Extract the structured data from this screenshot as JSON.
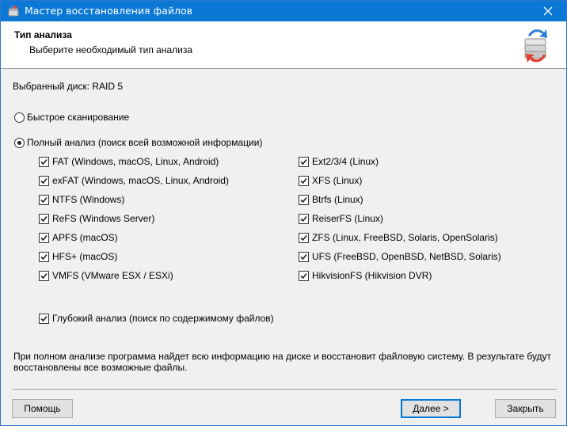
{
  "window": {
    "title": "Мастер восстановления файлов",
    "close_label": "✕"
  },
  "header": {
    "title": "Тип анализа",
    "subtitle": "Выберите необходимый тип анализа",
    "icon": "restore-drive-icon"
  },
  "disk": {
    "label": "Выбранный диск: RAID 5"
  },
  "scan_modes": [
    {
      "label": "Быстрое сканирование",
      "selected": false
    },
    {
      "label": "Полный анализ (поиск всей возможной информации)",
      "selected": true
    }
  ],
  "filesystems_left": [
    {
      "label": "FAT (Windows, macOS, Linux, Android)",
      "checked": true
    },
    {
      "label": "exFAT (Windows, macOS, Linux, Android)",
      "checked": true
    },
    {
      "label": "NTFS (Windows)",
      "checked": true
    },
    {
      "label": "ReFS (Windows Server)",
      "checked": true
    },
    {
      "label": "APFS (macOS)",
      "checked": true
    },
    {
      "label": "HFS+ (macOS)",
      "checked": true
    },
    {
      "label": "VMFS (VMware ESX / ESXi)",
      "checked": true
    }
  ],
  "filesystems_right": [
    {
      "label": "Ext2/3/4 (Linux)",
      "checked": true
    },
    {
      "label": "XFS (Linux)",
      "checked": true
    },
    {
      "label": "Btrfs (Linux)",
      "checked": true
    },
    {
      "label": "ReiserFS (Linux)",
      "checked": true
    },
    {
      "label": "ZFS (Linux, FreeBSD, Solaris, OpenSolaris)",
      "checked": true
    },
    {
      "label": "UFS (FreeBSD, OpenBSD, NetBSD, Solaris)",
      "checked": true
    },
    {
      "label": "HikvisionFS (Hikvision DVR)",
      "checked": true
    }
  ],
  "deep_analysis": {
    "label": "Глубокий анализ (поиск по содержимому файлов)",
    "checked": true
  },
  "description": {
    "line1": "При полном анализе программа найдет всю информацию на диске и восстановит файловую систему. В результате будут",
    "line2": "восстановлены все возможные файлы."
  },
  "buttons": {
    "help": "Помощь",
    "next": "Далее >",
    "close": "Закрыть"
  },
  "colors": {
    "titlebar": "#0a78d4",
    "accent": "#0078d7"
  }
}
